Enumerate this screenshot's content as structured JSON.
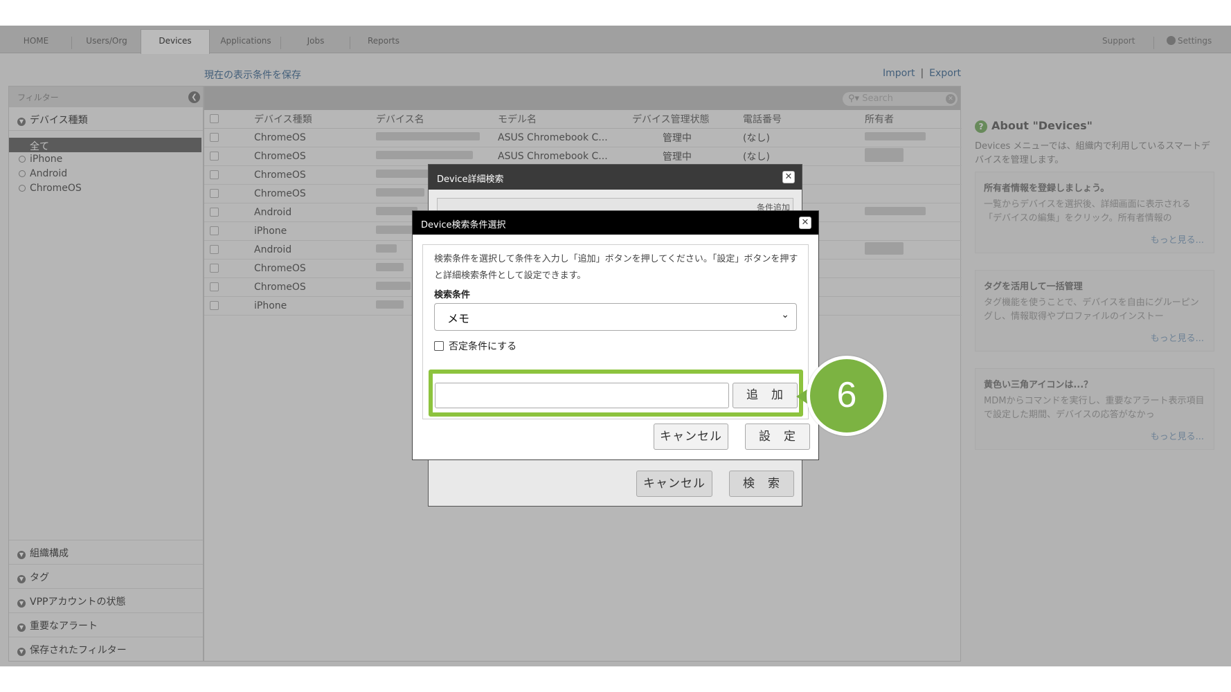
{
  "nav": {
    "tabs": [
      "HOME",
      "Users/Org",
      "Devices",
      "Applications",
      "Jobs",
      "Reports"
    ],
    "support": "Support",
    "settings": "Settings"
  },
  "toolbar": {
    "save_view": "現在の表示条件を保存",
    "import": "Import",
    "separator": "|",
    "export": "Export"
  },
  "sidebar": {
    "title": "フィルター",
    "device_type": "デバイス種類",
    "items": [
      "全て",
      "iPhone",
      "Android",
      "ChromeOS"
    ],
    "sections": [
      "組織構成",
      "タグ",
      "VPPアカウントの状態",
      "重要なアラート",
      "保存されたフィルター"
    ]
  },
  "search": {
    "placeholder": "Search"
  },
  "table": {
    "headers": [
      "デバイス種類",
      "デバイス名",
      "モデル名",
      "デバイス管理状態",
      "電話番号",
      "所有者"
    ],
    "rows": [
      {
        "type": "ChromeOS",
        "model": "ASUS Chromebook C...",
        "state": "管理中",
        "phone": "(なし)"
      },
      {
        "type": "ChromeOS",
        "model": "ASUS Chromebook C...",
        "state": "管理中",
        "phone": "(なし)"
      },
      {
        "type": "ChromeOS",
        "model": "",
        "state": "",
        "phone": ""
      },
      {
        "type": "ChromeOS",
        "model": "",
        "state": "",
        "phone": ""
      },
      {
        "type": "Android",
        "model": "",
        "state": "",
        "phone": ""
      },
      {
        "type": "iPhone",
        "model": "",
        "state": "",
        "phone": ""
      },
      {
        "type": "Android",
        "model": "",
        "state": "",
        "phone": ""
      },
      {
        "type": "ChromeOS",
        "model": "",
        "state": "",
        "phone": ""
      },
      {
        "type": "ChromeOS",
        "model": "",
        "state": "",
        "phone": ""
      },
      {
        "type": "iPhone",
        "model": "",
        "state": "",
        "phone": ""
      }
    ]
  },
  "right_panel": {
    "title": "About \"Devices\"",
    "desc": "Devices メニューでは、組織内で利用しているスマートデバイスを管理します。",
    "cards": [
      {
        "title": "所有者情報を登録しましょう。",
        "desc": "一覧からデバイスを選択後、詳細画面に表示される「デバイスの編集」をクリック。所有者情報の",
        "more": "もっと見る..."
      },
      {
        "title": "タグを活用して一括管理",
        "desc": "タグ機能を使うことで、デバイスを自由にグルーピングし、情報取得やプロファイルのインストー",
        "more": "もっと見る..."
      },
      {
        "title": "黄色い三角アイコンは...？",
        "desc": "MDMからコマンドを実行し、重要なアラート表示項目で設定した期間、デバイスの応答がなかっ",
        "more": "もっと見る..."
      }
    ]
  },
  "dialog_detail": {
    "title": "Device詳細検索",
    "add_condition": "条件追加",
    "cancel": "キャンセル",
    "search": "検　索"
  },
  "dialog_select": {
    "title": "Device検索条件選択",
    "instruction": "検索条件を選択して条件を入力し「追加」ボタンを押してください。「設定」ボタンを押すと詳細検索条件として設定できます。",
    "condition_label": "検索条件",
    "condition_value": "メモ",
    "negate_label": "否定条件にする",
    "value_input": "",
    "add": "追　加",
    "cancel": "キャンセル",
    "set": "設　定"
  },
  "step_badge": "6",
  "colors": {
    "highlight": "#8dc33e",
    "badge": "#7cb342",
    "link": "#5a7fa3"
  }
}
